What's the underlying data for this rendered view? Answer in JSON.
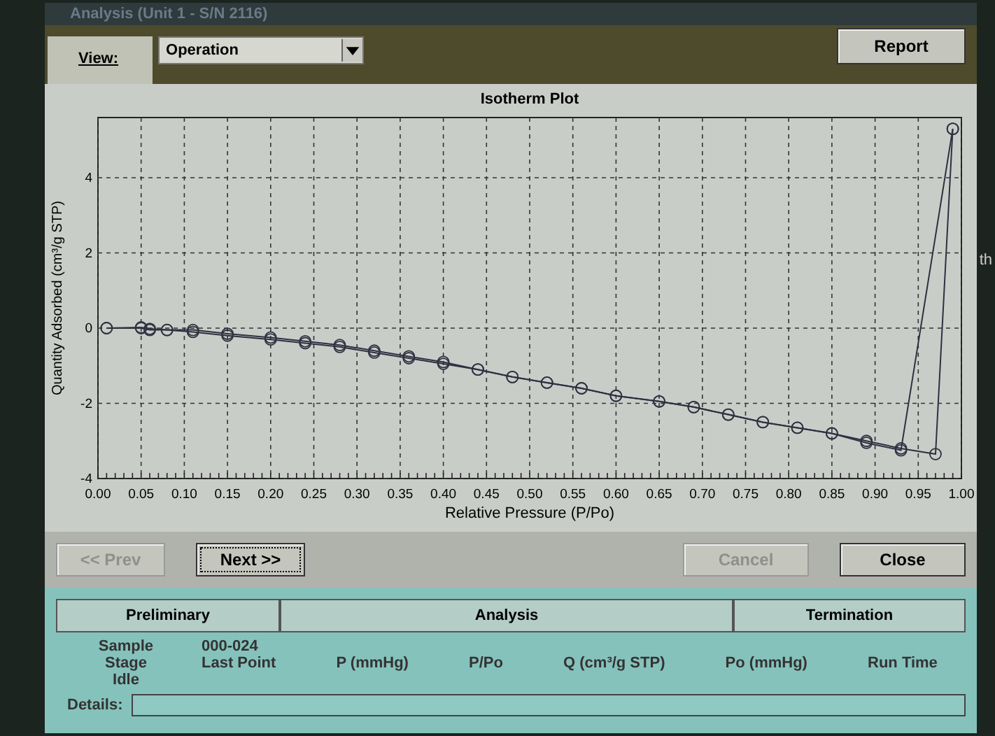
{
  "window": {
    "title": "Analysis (Unit 1 - S/N 2116)"
  },
  "toolbar": {
    "view_label": "View:",
    "view_value": "Operation",
    "report_button": "Report"
  },
  "plot": {
    "chart_data": {
      "type": "line",
      "title": "Isotherm Plot",
      "xlabel": "Relative Pressure (P/Po)",
      "ylabel": "Quantity Adsorbed (cm³/g STP)",
      "x": [
        0.01,
        0.05,
        0.06,
        0.08,
        0.11,
        0.15,
        0.2,
        0.24,
        0.28,
        0.32,
        0.36,
        0.4,
        0.44,
        0.48,
        0.52,
        0.56,
        0.6,
        0.65,
        0.69,
        0.73,
        0.77,
        0.81,
        0.85,
        0.89,
        0.93,
        0.97,
        0.99
      ],
      "series": [
        {
          "color": "#303040",
          "marker": "circle",
          "values": [
            0,
            0,
            -0.05,
            -0.05,
            -0.1,
            -0.2,
            -0.3,
            -0.4,
            -0.5,
            -0.65,
            -0.8,
            -0.95,
            -1.1,
            -1.3,
            -1.45,
            -1.6,
            -1.8,
            -1.95,
            -2.1,
            -2.3,
            -2.5,
            -2.65,
            -2.8,
            -3.0,
            -3.2,
            -3.35,
            5.3
          ]
        },
        {
          "color": "#303040",
          "marker": "circle",
          "values": [
            0,
            0.02,
            -0.02,
            -0.05,
            -0.05,
            -0.15,
            -0.25,
            -0.35,
            -0.45,
            -0.6,
            -0.75,
            -0.9,
            -1.1,
            -1.3,
            -1.45,
            -1.6,
            -1.8,
            -1.95,
            -2.1,
            -2.3,
            -2.5,
            -2.65,
            -2.8,
            -3.05,
            -3.25,
            null,
            5.3
          ]
        }
      ],
      "grid": true,
      "xlim": [
        0,
        1
      ],
      "ylim": [
        -4,
        5.6
      ],
      "xticks": [
        {
          "value": 0,
          "label": "0.00"
        },
        {
          "value": 0.05,
          "label": "0.05"
        },
        {
          "value": 0.1,
          "label": "0.10"
        },
        {
          "value": 0.15,
          "label": "0.15"
        },
        {
          "value": 0.2,
          "label": "0.20"
        },
        {
          "value": 0.25,
          "label": "0.25"
        },
        {
          "value": 0.3,
          "label": "0.30"
        },
        {
          "value": 0.35,
          "label": "0.35"
        },
        {
          "value": 0.4,
          "label": "0.40"
        },
        {
          "value": 0.45,
          "label": "0.45"
        },
        {
          "value": 0.5,
          "label": "0.50"
        },
        {
          "value": 0.55,
          "label": "0.55"
        },
        {
          "value": 0.6,
          "label": "0.60"
        },
        {
          "value": 0.65,
          "label": "0.65"
        },
        {
          "value": 0.7,
          "label": "0.70"
        },
        {
          "value": 0.75,
          "label": "0.75"
        },
        {
          "value": 0.8,
          "label": "0.80"
        },
        {
          "value": 0.85,
          "label": "0.85"
        },
        {
          "value": 0.9,
          "label": "0.90"
        },
        {
          "value": 0.95,
          "label": "0.95"
        },
        {
          "value": 1,
          "label": "1.00"
        }
      ],
      "yticks": [
        -4,
        -2,
        0,
        2,
        4
      ]
    }
  },
  "nav_buttons": [
    {
      "label": "<< Prev",
      "disabled": true,
      "focused": false
    },
    {
      "label": "Next >>",
      "disabled": false,
      "focused": true
    },
    {
      "label": "Cancel",
      "disabled": true,
      "focused": false
    },
    {
      "label": "Close",
      "disabled": false,
      "focused": false
    }
  ],
  "stages": [
    {
      "label": "Preliminary"
    },
    {
      "label": "Analysis"
    },
    {
      "label": "Termination"
    }
  ],
  "status": {
    "sample_label": "Sample",
    "sample_value": "000-024",
    "stage_label": "Stage",
    "stage_value": "Idle",
    "columns": [
      "Last Point",
      "P (mmHg)",
      "P/Po",
      "Q (cm³/g STP)",
      "Po (mmHg)",
      "Run Time"
    ],
    "details_label": "Details:"
  },
  "background": {
    "text": "th"
  }
}
